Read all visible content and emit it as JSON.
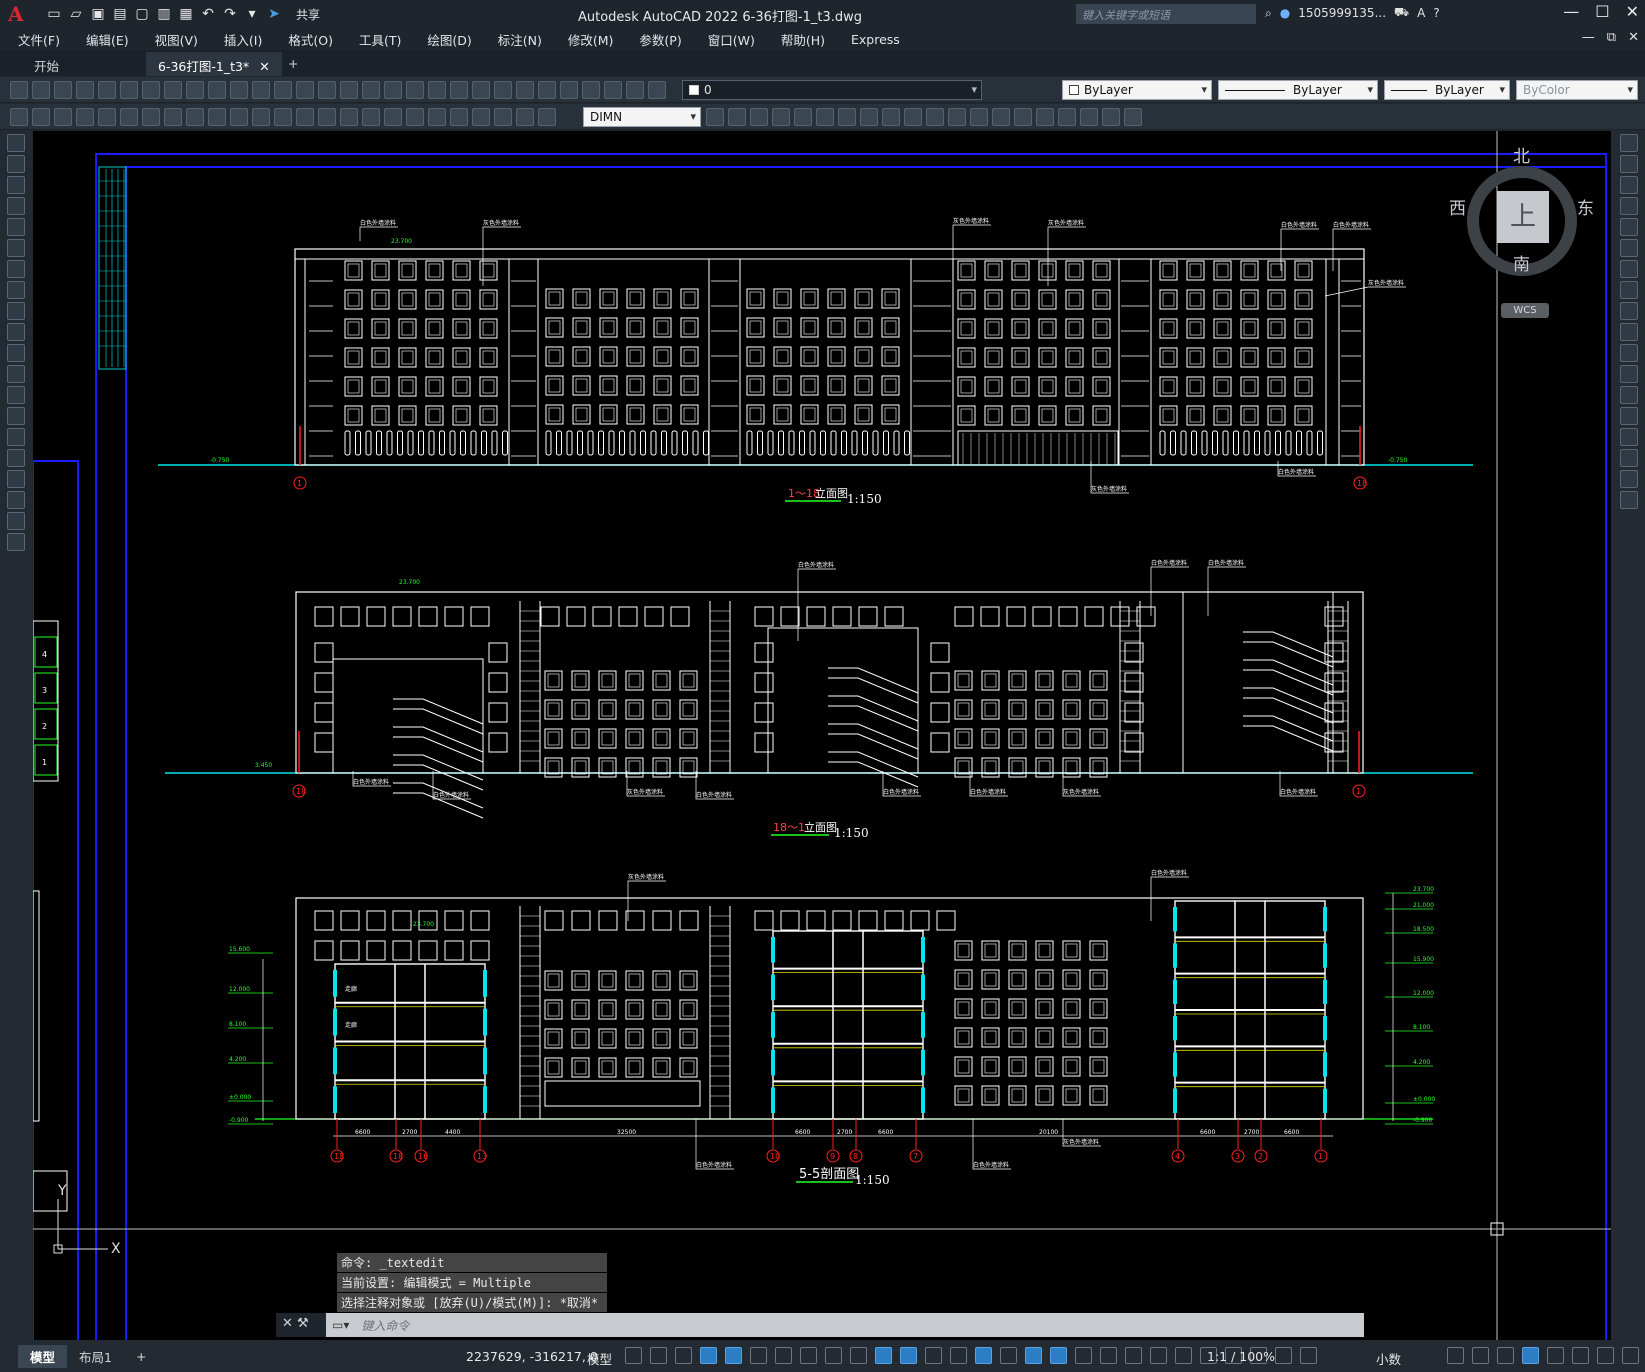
{
  "app": {
    "title": "Autodesk AutoCAD 2022    6-36打图-1_t3.dwg",
    "logo": "A",
    "share_label": "共享",
    "search_placeholder": "键入关键字或短语",
    "user": "1505999135...",
    "window_buttons": [
      "—",
      "☐",
      "✕"
    ],
    "mdi_buttons": [
      "—",
      "⧉",
      "✕"
    ]
  },
  "menu": [
    "文件(F)",
    "编辑(E)",
    "视图(V)",
    "插入(I)",
    "格式(O)",
    "工具(T)",
    "绘图(D)",
    "标注(N)",
    "修改(M)",
    "参数(P)",
    "窗口(W)",
    "帮助(H)",
    "Express"
  ],
  "tabs": {
    "start": "开始",
    "active": "6-36打图-1_t3*",
    "close": "✕",
    "add": "+"
  },
  "toolbar": {
    "layer_value": "0",
    "color_value": "ByLayer",
    "linetype_value": "ByLayer",
    "lineweight_value": "ByLayer",
    "plotstyle_value": "ByColor",
    "dimstyle_value": "DIMN"
  },
  "viewcube": {
    "north": "北",
    "south": "南",
    "west": "西",
    "east": "东",
    "face": "上",
    "wcs": "WCS"
  },
  "drawing": {
    "title1_num": "1～18",
    "title1_text": "立面图",
    "title1_scale": "1:150",
    "title2_num": "18～1",
    "title2_text": "立面图",
    "title2_scale": "1:150",
    "title3_text": "5-5剖面图",
    "title3_scale": "1:150",
    "axis_start": "1",
    "axis_end": "18",
    "elev_top": "23.700",
    "elev_ground": "-0.750",
    "note_white": "白色外墙涂料",
    "note_gray": "灰色外墙涂料",
    "section_axes": [
      "18",
      "18",
      "16",
      "13",
      "10",
      "9",
      "8",
      "7",
      "4",
      "3",
      "2",
      "1"
    ],
    "section_dims": [
      "6600",
      "2700",
      "4400",
      "32500",
      "6600",
      "2700",
      "6600",
      "20100",
      "6600",
      "2700",
      "6600"
    ],
    "section_levels": [
      "15.600",
      "12.000",
      "8.100",
      "4.200",
      "±0.000",
      "-0.900"
    ],
    "section_levels_right": [
      "23.700",
      "21.000",
      "18.500",
      "15.900",
      "12.000",
      "8.100",
      "4.200",
      "±0.000",
      "-0.900"
    ]
  },
  "command": {
    "history": [
      "命令: _textedit",
      "当前设置: 编辑模式 = Multiple",
      "选择注释对象或 [放弃(U)/模式(M)]: *取消*"
    ],
    "placeholder": "键入命令",
    "close": "✕"
  },
  "status": {
    "tab_model": "模型",
    "tab_layout": "布局1",
    "tab_add": "+",
    "coords": "2237629, -316217, 0",
    "model": "模型",
    "scale": "1:1 / 100%",
    "units": "小数"
  },
  "colors": {
    "canvas": "#000000",
    "line": "#ffffff",
    "ground": "#00e5ee",
    "frame": "#1a1aff",
    "axis": "#ff2020",
    "dim": "#20ff20",
    "accent": "#2c7ec4"
  }
}
